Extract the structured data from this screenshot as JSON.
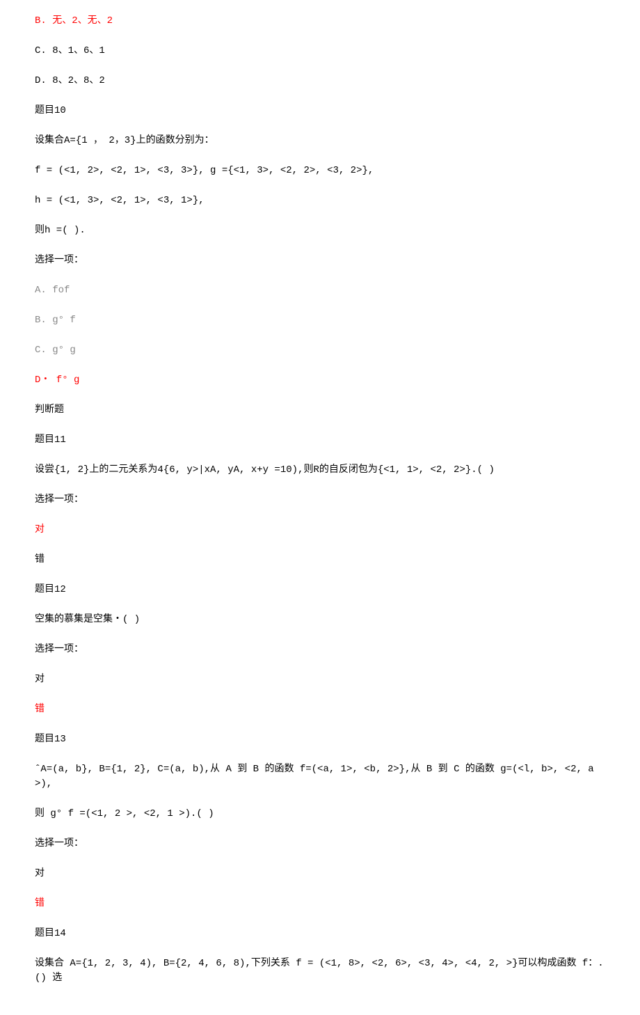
{
  "lines": [
    {
      "text": "B.  无、2、无、2",
      "class": "red"
    },
    {
      "text": "C.  8、1、6、1"
    },
    {
      "text": "D.  8、2、8、2"
    },
    {
      "text": "题目10"
    },
    {
      "text": "设集合A={1 ， 2，3}上的函数分别为："
    },
    {
      "text": "f = (<1, 2>, <2, 1>, <3, 3>}, g ={<1, 3>, <2, 2>, <3, 2>},"
    },
    {
      "text": "h = (<1, 3>, <2, 1>, <3, 1>},"
    },
    {
      "text": "则h =(      )."
    },
    {
      "text": "选择一项："
    },
    {
      "text": "A.  fof",
      "class": "gray"
    },
    {
      "text": "B.  g° f",
      "class": "gray"
    },
    {
      "text": "C.  g° g",
      "class": "gray"
    },
    {
      "text": "D・  f° g",
      "class": "red"
    },
    {
      "text": "判断题"
    },
    {
      "text": "题目11"
    },
    {
      "text": "设尝{1, 2}上的二元关系为4{6, y>|xA, yA, x+y =10),则R的自反闭包为{<1, 1>, <2, 2>}.(            )"
    },
    {
      "text": "选择一项："
    },
    {
      "text": "对",
      "class": "red"
    },
    {
      "text": "错"
    },
    {
      "text": "题目12"
    },
    {
      "text": "空集的慕集是空集・(    )"
    },
    {
      "text": "选择一项："
    },
    {
      "text": "对"
    },
    {
      "text": "错",
      "class": "red"
    },
    {
      "text": "题目13"
    },
    {
      "text": "ˆA=(a, b}, B={1, 2}, C=(a, b),从 A 到 B 的函数 f=(<a, 1>, <b, 2>},从 B 到 C 的函数 g=(<l, b>, <2, a >),"
    },
    {
      "text": "则 g°  f =(<1, 2 >, <2, 1 >).(     )"
    },
    {
      "text": "选择一项："
    },
    {
      "text": "对"
    },
    {
      "text": "错",
      "class": "red"
    },
    {
      "text": "题目14"
    },
    {
      "text": "设集合 A={1, 2, 3, 4), B={2, 4, 6, 8),下列关系 f = (<1, 8>, <2, 6>, <3, 4>, <4, 2, >}可以构成函数 f：.() 选"
    }
  ]
}
